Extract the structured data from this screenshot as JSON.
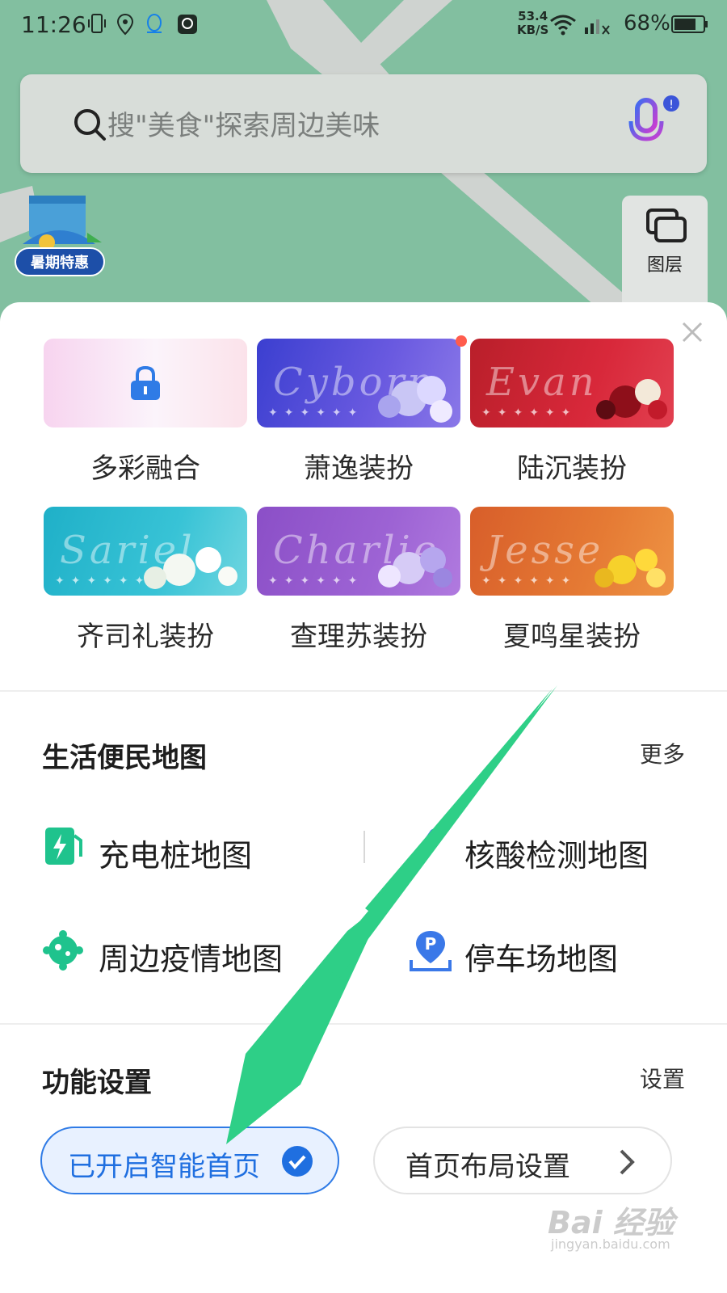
{
  "status_bar": {
    "time": "11:26",
    "net_speed_value": "53.4",
    "net_speed_unit": "KB/S",
    "battery": "68%"
  },
  "search": {
    "placeholder": "搜\"美食\"探索周边美味"
  },
  "promo": {
    "label": "暑期特惠"
  },
  "layer": {
    "label": "图层"
  },
  "themes": [
    {
      "label": "多彩融合",
      "script": "",
      "locked": true
    },
    {
      "label": "萧逸装扮",
      "script": "Cyborn"
    },
    {
      "label": "陆沉装扮",
      "script": "Evan"
    },
    {
      "label": "齐司礼装扮",
      "script": "Sariel"
    },
    {
      "label": "查理苏装扮",
      "script": "Charlie"
    },
    {
      "label": "夏鸣星装扮",
      "script": "Jesse"
    }
  ],
  "life_maps": {
    "title": "生活便民地图",
    "more": "更多",
    "items": [
      {
        "label": "充电桩地图",
        "icon": "charging-station-icon"
      },
      {
        "label": "核酸检测地图",
        "icon": "test-tube-icon"
      },
      {
        "label": "周边疫情地图",
        "icon": "virus-icon"
      },
      {
        "label": "停车场地图",
        "icon": "parking-icon"
      }
    ]
  },
  "function_settings": {
    "title": "功能设置",
    "settings_link": "设置",
    "smart_home": "已开启智能首页",
    "layout_settings": "首页布局设置"
  },
  "watermark": {
    "text": "Bai 经验",
    "url": "jingyan.baidu.com"
  },
  "colors": {
    "map_green": "#82bfa0",
    "accent_blue": "#1f6fe0",
    "arrow_green": "#2ecf87"
  }
}
